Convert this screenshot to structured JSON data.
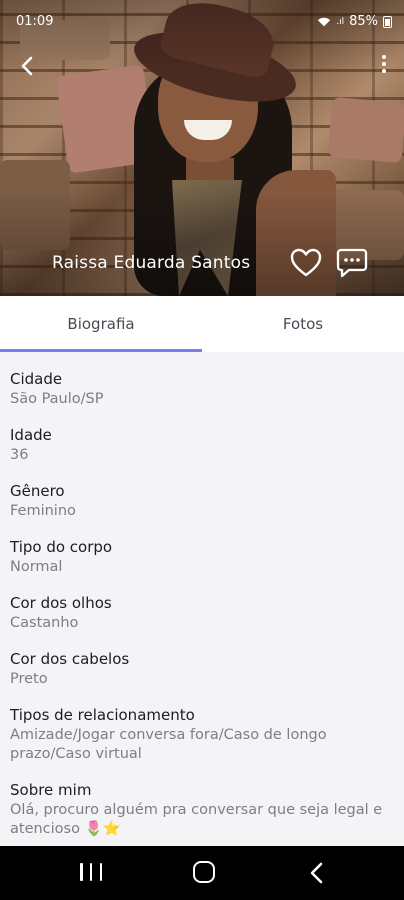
{
  "status_bar": {
    "time": "01:09",
    "battery": "85%"
  },
  "profile": {
    "name": "Raissa Eduarda Santos"
  },
  "tabs": [
    {
      "label": "Biografia",
      "active": true
    },
    {
      "label": "Fotos",
      "active": false
    }
  ],
  "details": [
    {
      "label": "Cidade",
      "value": "São Paulo/SP"
    },
    {
      "label": "Idade",
      "value": "36"
    },
    {
      "label": "Gênero",
      "value": "Feminino"
    },
    {
      "label": "Tipo do corpo",
      "value": "Normal"
    },
    {
      "label": "Cor dos olhos",
      "value": "Castanho"
    },
    {
      "label": "Cor dos cabelos",
      "value": "Preto"
    },
    {
      "label": "Tipos de relacionamento",
      "value": "Amizade/Jogar conversa fora/Caso de longo prazo/Caso virtual"
    },
    {
      "label": "Sobre mim",
      "value": "Olá, procuro alguém pra conversar que seja legal e atencioso 🌷⭐"
    }
  ],
  "colors": {
    "accent": "#7b7cf0",
    "label": "#1d1d22",
    "value": "#7d7d86"
  },
  "icons": [
    "back-arrow-icon",
    "more-vert-icon",
    "heart-icon",
    "chat-icon",
    "wifi-icon",
    "battery-icon"
  ]
}
